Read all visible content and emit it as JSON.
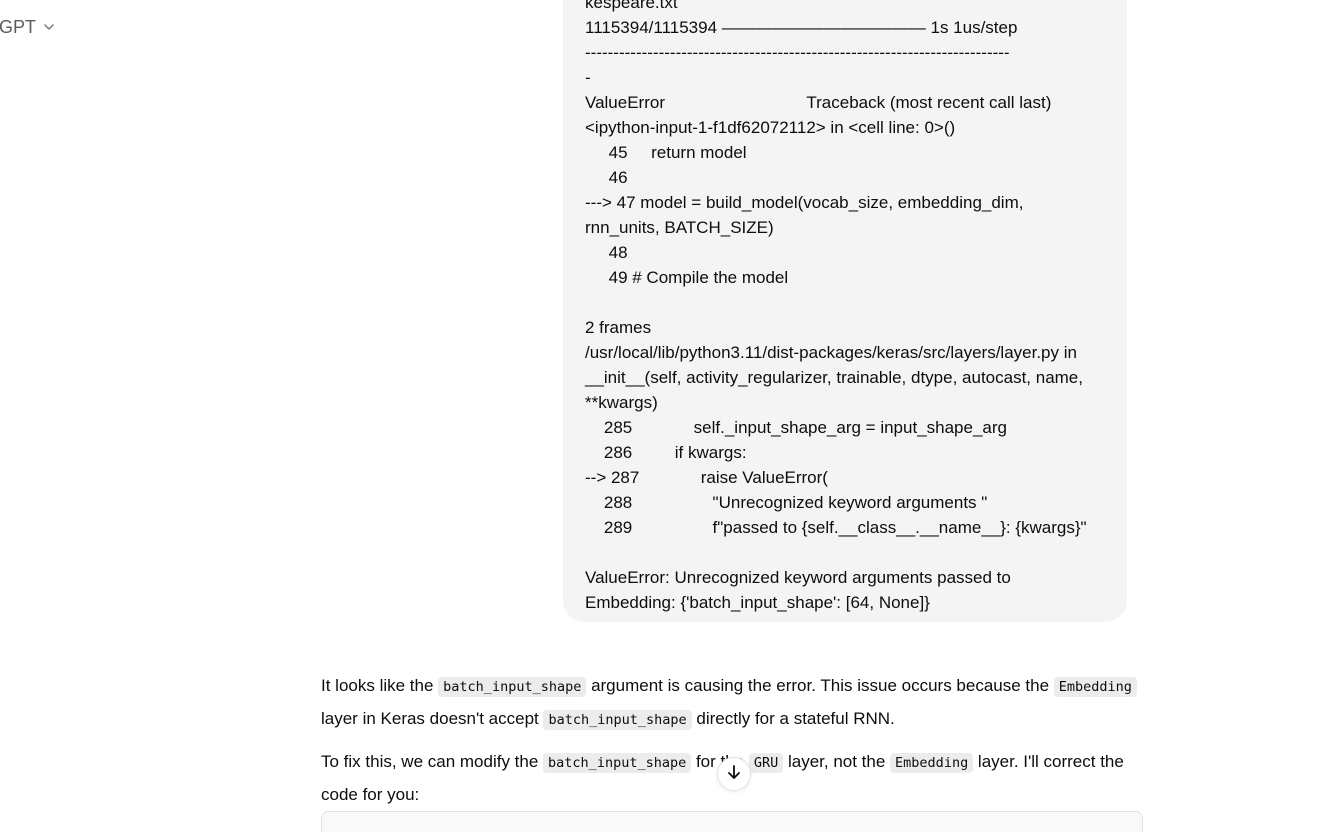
{
  "header": {
    "model_label": "tGPT"
  },
  "user_message": {
    "lines": [
      {
        "text": "kespeare.txt",
        "indent": 0
      },
      {
        "text": "1115394/1115394 ———————————— 1s 1us/step",
        "indent": 0
      },
      {
        "text": "---------------------------------------------------------------------------",
        "indent": 0
      },
      {
        "text": "-",
        "indent": 0
      },
      {
        "text": "ValueError                              Traceback (most recent call last)",
        "indent": 0
      },
      {
        "text": "<ipython-input-1-f1df62072112> in <cell line: 0>()",
        "indent": 0
      },
      {
        "text": "     45     return model",
        "indent": 0
      },
      {
        "text": "     46",
        "indent": 0
      },
      {
        "text": "---> 47 model = build_model(vocab_size, embedding_dim,",
        "indent": 0
      },
      {
        "text": "rnn_units, BATCH_SIZE)",
        "indent": 0
      },
      {
        "text": "     48",
        "indent": 0
      },
      {
        "text": "     49 # Compile the model",
        "indent": 0
      },
      {
        "text": "",
        "indent": 0
      },
      {
        "text": "2 frames",
        "indent": 0
      },
      {
        "text": "/usr/local/lib/python3.11/dist-packages/keras/src/layers/layer.py in",
        "indent": 0
      },
      {
        "text": "__init__(self, activity_regularizer, trainable, dtype, autocast, name,",
        "indent": 0
      },
      {
        "text": "**kwargs)",
        "indent": 0
      },
      {
        "text": "    285             self._input_shape_arg = input_shape_arg",
        "indent": 0
      },
      {
        "text": "    286         if kwargs:",
        "indent": 0
      },
      {
        "text": "--> 287             raise ValueError(",
        "indent": 0
      },
      {
        "text": "    288                 \"Unrecognized keyword arguments \"",
        "indent": 0
      },
      {
        "text": "    289                 f\"passed to {self.__class__.__name__}: {kwargs}\"",
        "indent": 0
      },
      {
        "text": "",
        "indent": 0
      },
      {
        "text": "ValueError: Unrecognized keyword arguments passed to",
        "indent": 0
      },
      {
        "text": "Embedding: {'batch_input_shape': [64, None]}",
        "indent": 0
      }
    ]
  },
  "assistant_message": {
    "p1": {
      "t1": "It looks like the ",
      "c1": "batch_input_shape",
      "t2": " argument is causing the error. This issue occurs because the ",
      "c2": "Embedding",
      "t3": " layer in Keras doesn't accept ",
      "c3": "batch_input_shape",
      "t4": " directly for a stateful RNN."
    },
    "p2": {
      "t1": "To fix this, we can modify the ",
      "c1": "batch_input_shape",
      "t2": " for the ",
      "c2": "GRU",
      "t3": " layer, not the ",
      "c3": "Embedding",
      "t4": " layer. I'll correct the code for you:"
    }
  },
  "icons": {
    "model_chevron": "chevron-down-icon",
    "scroll_down": "arrow-down-icon"
  }
}
